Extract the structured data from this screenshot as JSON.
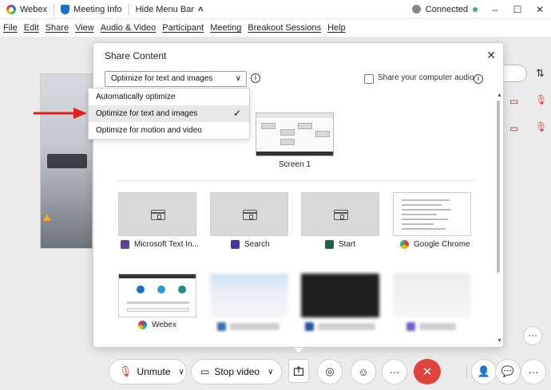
{
  "titlebar": {
    "app_name": "Webex",
    "meeting_info": "Meeting Info",
    "hide_menu_bar": "Hide Menu Bar",
    "connection_status": "Connected",
    "minimize": "–",
    "maximize": "☐",
    "close": "✕"
  },
  "menubar": {
    "items": [
      "File",
      "Edit",
      "Share",
      "View",
      "Audio & Video",
      "Participant",
      "Meeting",
      "Breakout Sessions",
      "Help"
    ]
  },
  "dialog": {
    "title": "Share Content",
    "close": "✕",
    "optimize_selected": "Optimize for text and images",
    "share_audio_label": "Share your computer audio",
    "dropdown_options": [
      {
        "label": "Automatically optimize",
        "selected": false
      },
      {
        "label": "Optimize for text and images",
        "selected": true
      },
      {
        "label": "Optimize for motion and video",
        "selected": false
      }
    ],
    "screens": [
      {
        "label": "Screen 1"
      }
    ],
    "apps": [
      {
        "label": "Microsoft Text In...",
        "icon": "text-input-icon",
        "color": "#5b3fa0"
      },
      {
        "label": "Search",
        "icon": "search-app-icon",
        "color": "#3d3aa8"
      },
      {
        "label": "Start",
        "icon": "start-app-icon",
        "color": "#1f5f4f"
      },
      {
        "label": "Google Chrome",
        "icon": "chrome-icon",
        "color": "#2bb673"
      },
      {
        "label": "Webex",
        "icon": "webex-icon",
        "color": "#1d6fce"
      }
    ]
  },
  "toolbar": {
    "unmute": "Unmute",
    "stop_video": "Stop video",
    "more": "···",
    "end": "✕"
  },
  "colors": {
    "end_call": "#e0423c",
    "arrow": "#e0211b",
    "connected_dot": "#2bb673"
  }
}
